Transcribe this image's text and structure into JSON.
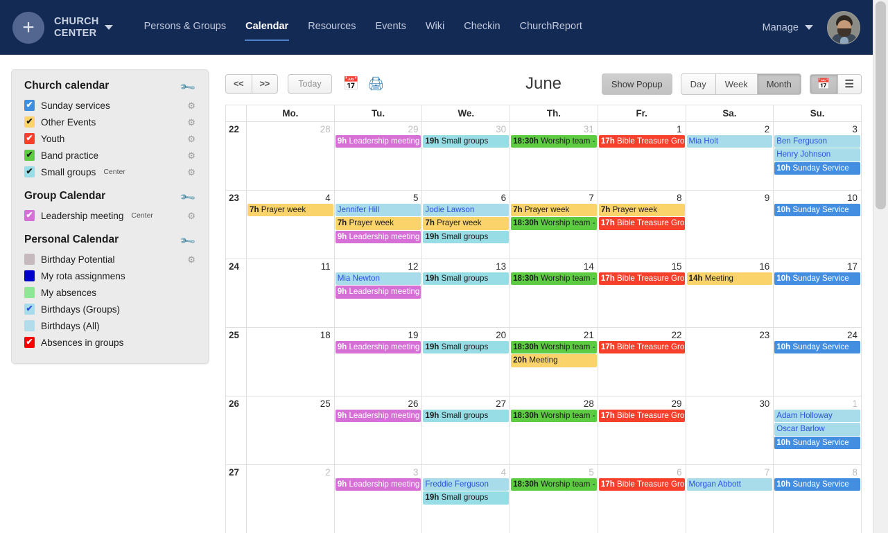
{
  "topnav": {
    "brand": "CHURCH\nCENTER",
    "logo_icon": "plus-icon",
    "brand_caret_icon": "chevron-down-icon",
    "menu": [
      {
        "label": "Persons & Groups",
        "active": false
      },
      {
        "label": "Calendar",
        "active": true
      },
      {
        "label": "Resources",
        "active": false
      },
      {
        "label": "Events",
        "active": false
      },
      {
        "label": "Wiki",
        "active": false
      },
      {
        "label": "Checkin",
        "active": false
      },
      {
        "label": "ChurchReport",
        "active": false
      }
    ],
    "manage_label": "Manage",
    "manage_caret_icon": "chevron-down-icon",
    "avatar_name": "user-avatar",
    "bg_color": "#132a55"
  },
  "sidebar": {
    "groups": [
      {
        "title": "Church calendar",
        "wrench_icon": "wrench-icon",
        "items": [
          {
            "label": "Sunday services",
            "suffix": "",
            "checked": true,
            "color": "#3c8fe0",
            "tick_color": "#ffffff",
            "gear": true
          },
          {
            "label": "Other Events",
            "suffix": "",
            "checked": true,
            "color": "#fad46b",
            "tick_color": "#1c1c1c",
            "gear": true
          },
          {
            "label": "Youth",
            "suffix": "",
            "checked": true,
            "color": "#f6402c",
            "tick_color": "#ffffff",
            "gear": true
          },
          {
            "label": "Band practice",
            "suffix": "",
            "checked": true,
            "color": "#5ecc42",
            "tick_color": "#1c1c1c",
            "gear": true
          },
          {
            "label": "Small groups",
            "suffix": "Center",
            "checked": true,
            "color": "#97dde5",
            "tick_color": "#1c1c1c",
            "gear": true
          }
        ]
      },
      {
        "title": "Group Calendar",
        "wrench_icon": "wrench-icon",
        "items": [
          {
            "label": "Leadership meeting",
            "suffix": "Center",
            "checked": true,
            "color": "#d66fd6",
            "tick_color": "#ffffff",
            "gear": true
          }
        ]
      },
      {
        "title": "Personal Calendar",
        "wrench_icon": "wrench-icon",
        "items": [
          {
            "label": "Birthday Potential",
            "suffix": "",
            "checked": false,
            "color": "#c6b9bd",
            "tick_color": "#ffffff",
            "gear": true
          },
          {
            "label": "My rota assignmens",
            "suffix": "",
            "checked": false,
            "color": "#0000cd",
            "tick_color": "#ffffff",
            "gear": false
          },
          {
            "label": "My absences",
            "suffix": "",
            "checked": false,
            "color": "#8ce894",
            "tick_color": "#1c1c1c",
            "gear": false
          },
          {
            "label": "Birthdays (Groups)",
            "suffix": "",
            "checked": true,
            "color": "#a8dcea",
            "tick_color": "#2a52dd",
            "gear": false
          },
          {
            "label": "Birthdays (All)",
            "suffix": "",
            "checked": false,
            "color": "#b3dcea",
            "tick_color": "#2a52dd",
            "gear": false
          },
          {
            "label": "Absences in groups",
            "suffix": "",
            "checked": true,
            "color": "#f70000",
            "tick_color": "#ffffff",
            "gear": false
          }
        ]
      }
    ]
  },
  "toolbar": {
    "prev_label": "<<",
    "next_label": ">>",
    "today_label": "Today",
    "calendar_icon": "calendar-icon",
    "print_icon": "printer-icon",
    "month_title": "June",
    "show_popup_label": "Show Popup",
    "views": [
      {
        "label": "Day",
        "active": false
      },
      {
        "label": "Week",
        "active": false
      },
      {
        "label": "Month",
        "active": true
      }
    ],
    "grid_view_icon": "calendar-grid-icon",
    "list_view_icon": "list-view-icon",
    "grid_view_active": true
  },
  "calendar": {
    "week_col_header": "",
    "day_headers": [
      "Mo.",
      "Tu.",
      "We.",
      "Th.",
      "Fr.",
      "Sa.",
      "Su."
    ],
    "weeks": [
      {
        "week_number": "22",
        "days": [
          {
            "num": "28",
            "other_month": true,
            "today": false,
            "events": []
          },
          {
            "num": "29",
            "other_month": true,
            "today": false,
            "events": [
              {
                "time": "9h",
                "title": "Leadership meeting",
                "type": "ev-purple"
              }
            ]
          },
          {
            "num": "30",
            "other_month": true,
            "today": false,
            "events": [
              {
                "time": "19h",
                "title": "Small groups",
                "type": "ev-cyan"
              }
            ]
          },
          {
            "num": "31",
            "other_month": true,
            "today": false,
            "events": [
              {
                "time": "18:30h",
                "title": "Worship team -",
                "type": "ev-green"
              }
            ]
          },
          {
            "num": "1",
            "other_month": false,
            "today": false,
            "events": [
              {
                "time": "17h",
                "title": "Bible Treasure Gro",
                "type": "ev-red"
              }
            ]
          },
          {
            "num": "2",
            "other_month": false,
            "today": false,
            "events": [
              {
                "time": "",
                "title": "Mia Holt",
                "type": "ev-bday"
              }
            ]
          },
          {
            "num": "3",
            "other_month": false,
            "today": false,
            "events": [
              {
                "time": "",
                "title": "Ben Ferguson",
                "type": "ev-bday"
              },
              {
                "time": "",
                "title": "Henry Johnson",
                "type": "ev-bday"
              },
              {
                "time": "10h",
                "title": "Sunday Service",
                "type": "ev-blue"
              }
            ]
          }
        ]
      },
      {
        "week_number": "23",
        "days": [
          {
            "num": "4",
            "other_month": false,
            "today": false,
            "events": [
              {
                "time": "7h",
                "title": "Prayer week",
                "type": "ev-yellow"
              }
            ]
          },
          {
            "num": "5",
            "other_month": false,
            "today": false,
            "events": [
              {
                "time": "",
                "title": "Jennifer Hill",
                "type": "ev-bday"
              },
              {
                "time": "7h",
                "title": "Prayer week",
                "type": "ev-yellow"
              },
              {
                "time": "9h",
                "title": "Leadership meeting",
                "type": "ev-purple"
              }
            ]
          },
          {
            "num": "6",
            "other_month": false,
            "today": false,
            "events": [
              {
                "time": "",
                "title": "Jodie Lawson",
                "type": "ev-bday"
              },
              {
                "time": "7h",
                "title": "Prayer week",
                "type": "ev-yellow"
              },
              {
                "time": "19h",
                "title": "Small groups",
                "type": "ev-cyan"
              }
            ]
          },
          {
            "num": "7",
            "other_month": false,
            "today": false,
            "events": [
              {
                "time": "7h",
                "title": "Prayer week",
                "type": "ev-yellow"
              },
              {
                "time": "18:30h",
                "title": "Worship team -",
                "type": "ev-green"
              }
            ]
          },
          {
            "num": "8",
            "other_month": false,
            "today": false,
            "events": [
              {
                "time": "7h",
                "title": "Prayer week",
                "type": "ev-yellow"
              },
              {
                "time": "17h",
                "title": "Bible Treasure Gro",
                "type": "ev-red"
              }
            ]
          },
          {
            "num": "9",
            "other_month": false,
            "today": false,
            "events": []
          },
          {
            "num": "10",
            "other_month": false,
            "today": false,
            "events": [
              {
                "time": "10h",
                "title": "Sunday Service",
                "type": "ev-blue"
              }
            ]
          }
        ]
      },
      {
        "week_number": "24",
        "days": [
          {
            "num": "11",
            "other_month": false,
            "today": false,
            "events": []
          },
          {
            "num": "12",
            "other_month": false,
            "today": false,
            "events": [
              {
                "time": "",
                "title": "Mia Newton",
                "type": "ev-bday"
              },
              {
                "time": "9h",
                "title": "Leadership meeting",
                "type": "ev-purple"
              }
            ]
          },
          {
            "num": "13",
            "other_month": false,
            "today": false,
            "events": [
              {
                "time": "19h",
                "title": "Small groups",
                "type": "ev-cyan"
              }
            ]
          },
          {
            "num": "14",
            "other_month": false,
            "today": false,
            "events": [
              {
                "time": "18:30h",
                "title": "Worship team -",
                "type": "ev-green"
              }
            ]
          },
          {
            "num": "15",
            "other_month": false,
            "today": false,
            "events": [
              {
                "time": "17h",
                "title": "Bible Treasure Gro",
                "type": "ev-red"
              }
            ]
          },
          {
            "num": "16",
            "other_month": false,
            "today": false,
            "events": [
              {
                "time": "14h",
                "title": "Meeting",
                "type": "ev-yellow"
              }
            ]
          },
          {
            "num": "17",
            "other_month": false,
            "today": false,
            "events": [
              {
                "time": "10h",
                "title": "Sunday Service",
                "type": "ev-blue"
              }
            ]
          }
        ]
      },
      {
        "week_number": "25",
        "days": [
          {
            "num": "18",
            "other_month": false,
            "today": false,
            "events": []
          },
          {
            "num": "19",
            "other_month": false,
            "today": false,
            "events": [
              {
                "time": "9h",
                "title": "Leadership meeting",
                "type": "ev-purple"
              }
            ]
          },
          {
            "num": "20",
            "other_month": false,
            "today": true,
            "events": [
              {
                "time": "19h",
                "title": "Small groups",
                "type": "ev-cyan"
              }
            ]
          },
          {
            "num": "21",
            "other_month": false,
            "today": false,
            "events": [
              {
                "time": "18:30h",
                "title": "Worship team -",
                "type": "ev-green"
              },
              {
                "time": "20h",
                "title": "Meeting",
                "type": "ev-yellow"
              }
            ]
          },
          {
            "num": "22",
            "other_month": false,
            "today": false,
            "events": [
              {
                "time": "17h",
                "title": "Bible Treasure Gro",
                "type": "ev-red"
              }
            ]
          },
          {
            "num": "23",
            "other_month": false,
            "today": false,
            "events": []
          },
          {
            "num": "24",
            "other_month": false,
            "today": false,
            "events": [
              {
                "time": "10h",
                "title": "Sunday Service",
                "type": "ev-blue"
              }
            ]
          }
        ]
      },
      {
        "week_number": "26",
        "days": [
          {
            "num": "25",
            "other_month": false,
            "today": false,
            "events": []
          },
          {
            "num": "26",
            "other_month": false,
            "today": false,
            "events": [
              {
                "time": "9h",
                "title": "Leadership meeting",
                "type": "ev-purple"
              }
            ]
          },
          {
            "num": "27",
            "other_month": false,
            "today": false,
            "events": [
              {
                "time": "19h",
                "title": "Small groups",
                "type": "ev-cyan"
              }
            ]
          },
          {
            "num": "28",
            "other_month": false,
            "today": false,
            "events": [
              {
                "time": "18:30h",
                "title": "Worship team -",
                "type": "ev-green"
              }
            ]
          },
          {
            "num": "29",
            "other_month": false,
            "today": false,
            "events": [
              {
                "time": "17h",
                "title": "Bible Treasure Gro",
                "type": "ev-red"
              }
            ]
          },
          {
            "num": "30",
            "other_month": false,
            "today": false,
            "events": []
          },
          {
            "num": "1",
            "other_month": true,
            "today": false,
            "events": [
              {
                "time": "",
                "title": "Adam Holloway",
                "type": "ev-bday"
              },
              {
                "time": "",
                "title": "Oscar Barlow",
                "type": "ev-bday"
              },
              {
                "time": "10h",
                "title": "Sunday Service",
                "type": "ev-blue"
              }
            ]
          }
        ]
      },
      {
        "week_number": "27",
        "days": [
          {
            "num": "2",
            "other_month": true,
            "today": false,
            "events": []
          },
          {
            "num": "3",
            "other_month": true,
            "today": false,
            "events": [
              {
                "time": "9h",
                "title": "Leadership meeting",
                "type": "ev-purple"
              }
            ]
          },
          {
            "num": "4",
            "other_month": true,
            "today": false,
            "events": [
              {
                "time": "",
                "title": "Freddie Ferguson",
                "type": "ev-bday"
              },
              {
                "time": "19h",
                "title": "Small groups",
                "type": "ev-cyan"
              }
            ]
          },
          {
            "num": "5",
            "other_month": true,
            "today": false,
            "events": [
              {
                "time": "18:30h",
                "title": "Worship team -",
                "type": "ev-green"
              }
            ]
          },
          {
            "num": "6",
            "other_month": true,
            "today": false,
            "events": [
              {
                "time": "17h",
                "title": "Bible Treasure Gro",
                "type": "ev-red"
              }
            ]
          },
          {
            "num": "7",
            "other_month": true,
            "today": false,
            "events": [
              {
                "time": "",
                "title": "Morgan Abbott",
                "type": "ev-bday"
              }
            ]
          },
          {
            "num": "8",
            "other_month": true,
            "today": false,
            "events": [
              {
                "time": "10h",
                "title": "Sunday Service",
                "type": "ev-blue"
              }
            ]
          }
        ]
      }
    ]
  }
}
